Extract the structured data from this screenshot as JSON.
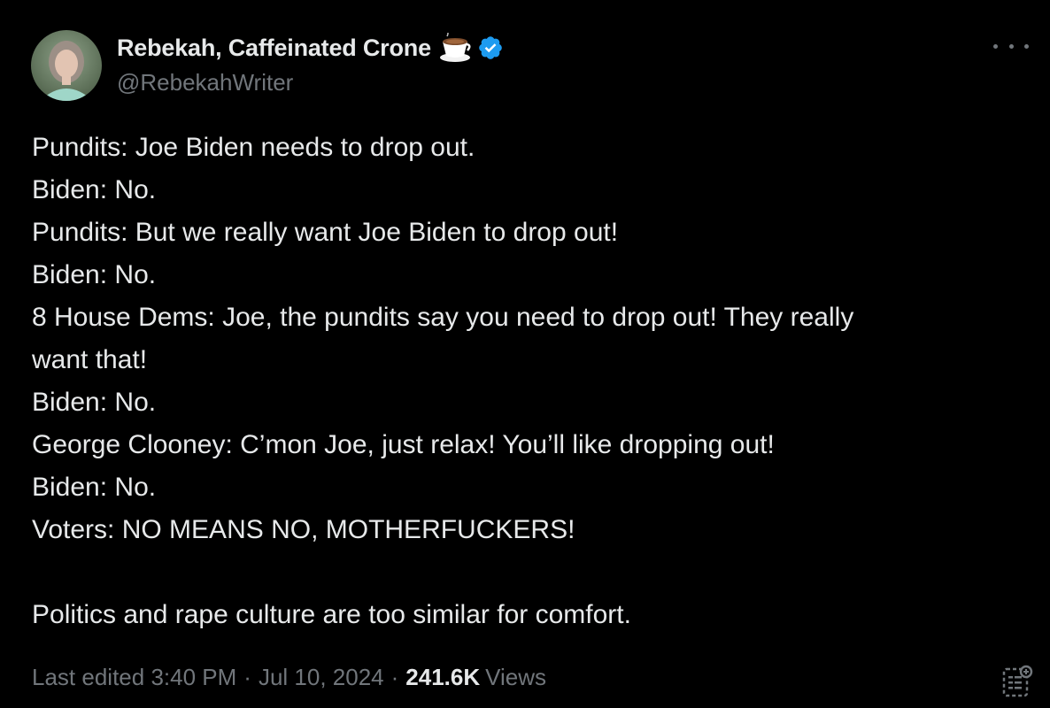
{
  "author": {
    "display_name": "Rebekah, Caffeinated Crone",
    "handle": "@RebekahWriter",
    "emoji": "coffee-cup-icon",
    "verified_color": "#1d9bf0"
  },
  "post": {
    "lines": [
      "Pundits: Joe Biden needs to drop out.",
      "Biden: No.",
      "Pundits: But we really want Joe Biden to drop out!",
      "Biden: No.",
      "8 House Dems: Joe, the pundits say you need to drop out! They really",
      "want that!",
      "Biden: No.",
      "George Clooney: C’mon Joe, just relax! You’ll like dropping out!",
      "Biden: No.",
      "Voters: NO MEANS NO, MOTHERFUCKERS!",
      "",
      "Politics and rape culture are too similar for comfort."
    ]
  },
  "meta": {
    "edited_label": "Last edited",
    "time": "3:40 PM",
    "separator": "·",
    "date": "Jul 10, 2024",
    "views_count": "241.6K",
    "views_label": "Views"
  },
  "colors": {
    "background": "#000000",
    "text": "#e7e9ea",
    "secondary": "#71767b",
    "accent": "#1d9bf0"
  }
}
